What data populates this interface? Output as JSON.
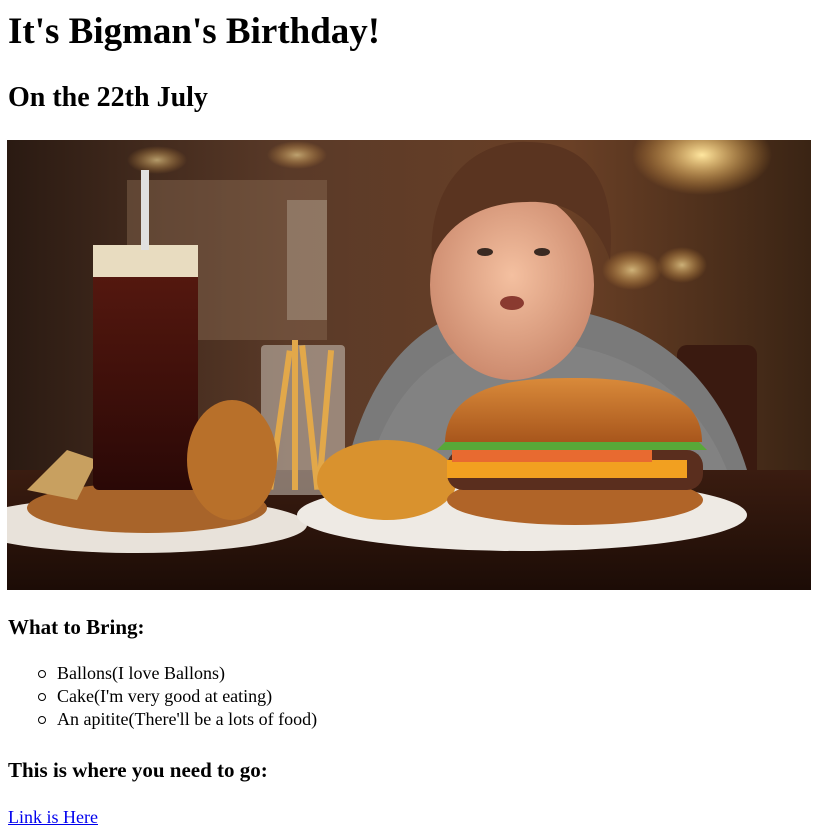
{
  "page": {
    "title": "It's Bigman's Birthday!",
    "subtitle": "On the 22th July"
  },
  "bring": {
    "heading": "What to Bring:",
    "items": [
      "Ballons(I love Ballons)",
      "Cake(I'm very good at eating)",
      "An apitite(There'll be a lots of food)"
    ]
  },
  "location": {
    "heading": "This is where you need to go:",
    "link_label": "Link is Here"
  },
  "colors": {
    "link": "#0000ee"
  }
}
